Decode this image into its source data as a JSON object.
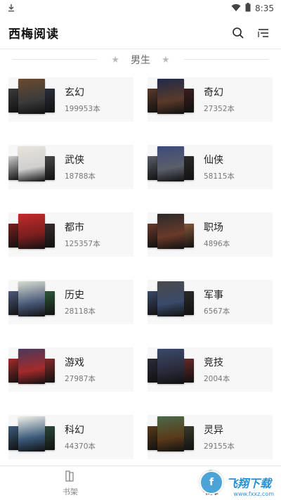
{
  "status": {
    "time": "8:35",
    "download_icon": "download-icon",
    "wifi_icon": "wifi-icon",
    "battery_icon": "battery-icon"
  },
  "app": {
    "title": "西梅阅读"
  },
  "section": {
    "title": "男生"
  },
  "categories": [
    {
      "name": "玄幻",
      "count": "199953本",
      "colors": [
        "#3b3b3b",
        "#6b4a2f",
        "#2a2f3a"
      ],
      "cover_text": ""
    },
    {
      "name": "奇幻",
      "count": "27352本",
      "colors": [
        "#5a3a2a",
        "#1f2a4a",
        "#3c1f1f"
      ],
      "cover_text": ""
    },
    {
      "name": "武侠",
      "count": "18788本",
      "colors": [
        "#cfcfcf",
        "#e8e4dc",
        "#4a4a4a"
      ],
      "cover_text": ""
    },
    {
      "name": "仙侠",
      "count": "58115本",
      "colors": [
        "#5b5f6a",
        "#3c4a7a",
        "#2b2b2b"
      ],
      "cover_text": ""
    },
    {
      "name": "都市",
      "count": "125357本",
      "colors": [
        "#7a1e1e",
        "#c42b2b",
        "#3a2a2a"
      ],
      "cover_text": ""
    },
    {
      "name": "职场",
      "count": "4896本",
      "colors": [
        "#6a3a2a",
        "#2a2a2a",
        "#8a5a3a"
      ],
      "cover_text": ""
    },
    {
      "name": "历史",
      "count": "28118本",
      "colors": [
        "#4a5a7a",
        "#d8dcd0",
        "#2f5a3a"
      ],
      "cover_text": ""
    },
    {
      "name": "军事",
      "count": "6567本",
      "colors": [
        "#3a4a6a",
        "#4a4a4a",
        "#2b2b2b"
      ],
      "cover_text": ""
    },
    {
      "name": "游戏",
      "count": "27987本",
      "colors": [
        "#a42a2a",
        "#4a3a5a",
        "#8a2a2a"
      ],
      "cover_text": ""
    },
    {
      "name": "竞技",
      "count": "2004本",
      "colors": [
        "#2a2a3a",
        "#3a4a6a",
        "#6a2a2a"
      ],
      "cover_text": ""
    },
    {
      "name": "科幻",
      "count": "44370本",
      "colors": [
        "#3a5a7a",
        "#f0efe8",
        "#2a4a3a"
      ],
      "cover_text": ""
    },
    {
      "name": "灵异",
      "count": "29155本",
      "colors": [
        "#5a3a1a",
        "#4a6a4a",
        "#3a3a2a"
      ],
      "cover_text": ""
    }
  ],
  "tabs": [
    {
      "label": "书架",
      "icon": "bookshelf-icon",
      "active": false
    },
    {
      "label": "书库",
      "icon": "compass-icon",
      "active": true
    }
  ],
  "watermark": {
    "text": "飞翔下载",
    "sub": "www.fxxz.com"
  }
}
